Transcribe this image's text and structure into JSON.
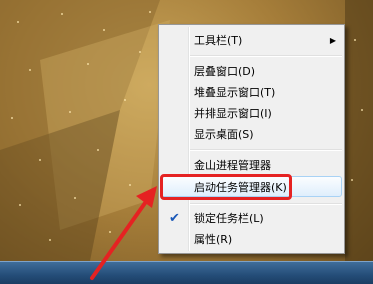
{
  "context_menu": {
    "items": [
      {
        "label": "工具栏(T)",
        "has_submenu": true,
        "checked": false
      },
      {
        "label": "层叠窗口(D)",
        "has_submenu": false,
        "checked": false
      },
      {
        "label": "堆叠显示窗口(T)",
        "has_submenu": false,
        "checked": false
      },
      {
        "label": "并排显示窗口(I)",
        "has_submenu": false,
        "checked": false
      },
      {
        "label": "显示桌面(S)",
        "has_submenu": false,
        "checked": false
      },
      {
        "label": "金山进程管理器",
        "has_submenu": false,
        "checked": false
      },
      {
        "label": "启动任务管理器(K)",
        "has_submenu": false,
        "checked": false,
        "highlighted": true
      },
      {
        "label": "锁定任务栏(L)",
        "has_submenu": false,
        "checked": true
      },
      {
        "label": "属性(R)",
        "has_submenu": false,
        "checked": false
      }
    ],
    "submenu_glyph": "▶",
    "check_glyph": "✔"
  },
  "annotation": {
    "color": "#e52222",
    "target": "启动任务管理器(K)"
  }
}
